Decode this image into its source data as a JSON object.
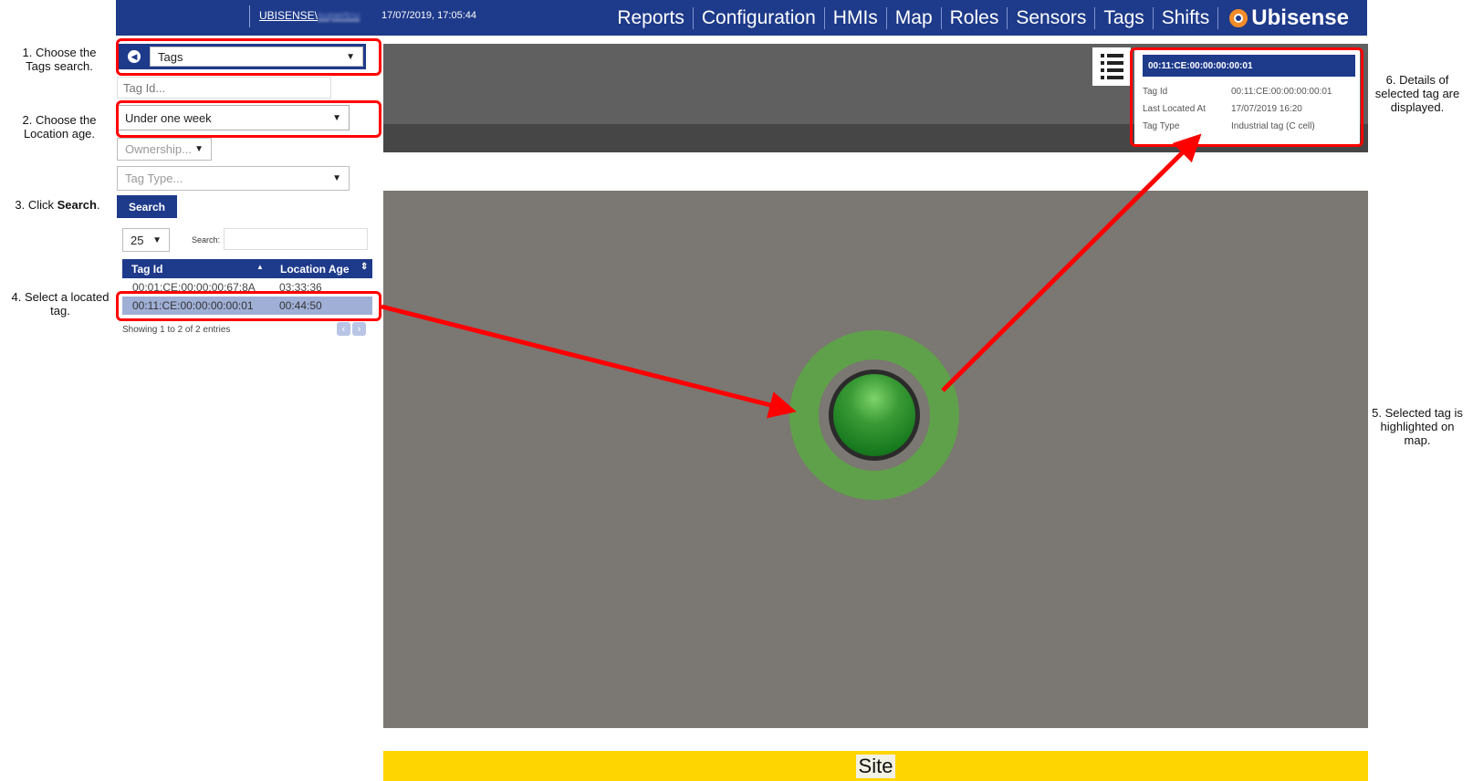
{
  "header": {
    "user_prefix": "UBISENSE\\",
    "user_blurred": "supertcu",
    "datetime": "17/07/2019, 17:05:44",
    "nav": [
      "Reports",
      "Configuration",
      "HMIs",
      "Map",
      "Roles",
      "Sensors",
      "Tags",
      "Shifts"
    ],
    "brand": "Ubisense"
  },
  "annotations": {
    "step1": "1. Choose the Tags search.",
    "step2": "2. Choose the Location age.",
    "step3_prefix": "3. Click ",
    "step3_bold": "Search",
    "step3_suffix": ".",
    "step4": "4. Select a located tag.",
    "step5": "5. Selected tag is highlighted on map.",
    "step6": "6. Details of selected tag are displayed."
  },
  "sidebar": {
    "search_type": "Tags",
    "tag_id_placeholder": "Tag Id...",
    "location_age": "Under one week",
    "ownership_placeholder": "Ownership...",
    "tag_type_placeholder": "Tag Type...",
    "search_button": "Search"
  },
  "results": {
    "page_size": "25",
    "search_label": "Search:",
    "columns": [
      "Tag Id",
      "Location Age"
    ],
    "rows": [
      {
        "tag_id": "00:01:CE:00:00:00:67:8A",
        "age": "03:33:36"
      },
      {
        "tag_id": "00:11:CE:00:00:00:00:01",
        "age": "00:44:50"
      }
    ],
    "entries_info": "Showing 1 to 2 of 2 entries",
    "selected_row": 1
  },
  "map": {
    "site_label": "Site"
  },
  "details": {
    "title": "00:11:CE:00:00:00:00:01",
    "fields": [
      {
        "label": "Tag Id",
        "value": "00:11:CE:00:00:00:00:01"
      },
      {
        "label": "Last Located At",
        "value": "17/07/2019 16:20"
      },
      {
        "label": "Tag Type",
        "value": "Industrial tag (C cell)"
      }
    ]
  },
  "colors": {
    "header_blue": "#1e3a8a",
    "highlight_red": "#ff0000",
    "site_yellow": "#ffd500",
    "tag_green": "#5fa14a",
    "selected_row": "#9fafd6",
    "brand_orange": "#f28c28"
  }
}
